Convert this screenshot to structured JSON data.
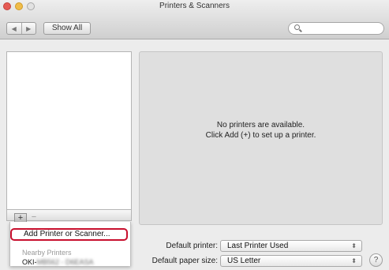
{
  "window": {
    "title": "Printers & Scanners"
  },
  "toolbar": {
    "back_icon": "◀",
    "forward_icon": "▶",
    "show_all_label": "Show All",
    "search_value": "",
    "search_placeholder": ""
  },
  "detail": {
    "line1": "No printers are available.",
    "line2": "Click Add (+) to set up a printer."
  },
  "list_controls": {
    "add_label": "+",
    "remove_label": "−"
  },
  "add_menu": {
    "add_printer_label": "Add Printer or Scanner...",
    "nearby_header": "Nearby Printers",
    "nearby_prefix": "OKI-",
    "nearby_obscured": "MB562 - D6EASA"
  },
  "defaults": {
    "printer_label": "Default printer:",
    "printer_value": "Last Printer Used",
    "paper_label": "Default paper size:",
    "paper_value": "US Letter"
  },
  "help": {
    "label": "?"
  },
  "colors": {
    "highlight_border": "#c8102e",
    "window_bg": "#ececec",
    "pane_bg": "#dfdfdf"
  }
}
